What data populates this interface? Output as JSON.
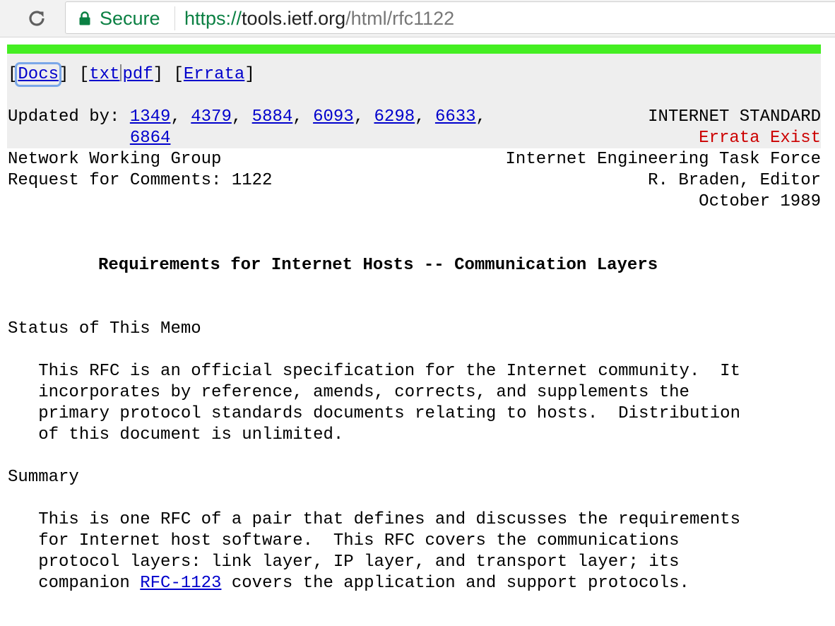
{
  "browser": {
    "secure_label": "Secure",
    "url_scheme": "https://",
    "url_host": "tools.ietf.org",
    "url_path": "/html/rfc1122"
  },
  "nav": {
    "docs": "Docs",
    "txt": "txt",
    "pdf": "pdf",
    "errata": "Errata"
  },
  "meta": {
    "updated_by_label": "Updated by: ",
    "updated_by": [
      "1349",
      "4379",
      "5884",
      "6093",
      "6298",
      "6633",
      "6864"
    ],
    "category": "INTERNET STANDARD",
    "errata_status": "Errata Exist"
  },
  "header": {
    "left": [
      "Network Working Group",
      "Request for Comments: 1122"
    ],
    "right": [
      "Internet Engineering Task Force",
      "R. Braden, Editor",
      "October 1989"
    ]
  },
  "title": "Requirements for Internet Hosts -- Communication Layers",
  "sections": {
    "status_heading": "Status of This Memo",
    "status_lines": [
      "   This RFC is an official specification for the Internet community.  It",
      "   incorporates by reference, amends, corrects, and supplements the",
      "   primary protocol standards documents relating to hosts.  Distribution",
      "   of this document is unlimited."
    ],
    "summary_heading": "Summary",
    "summary_lines": [
      "   This is one RFC of a pair that defines and discusses the requirements",
      "   for Internet host software.  This RFC covers the communications",
      "   protocol layers: link layer, IP layer, and transport layer; its"
    ],
    "summary_last_prefix": "   companion ",
    "summary_last_link": "RFC-1123",
    "summary_last_suffix": " covers the application and support protocols."
  },
  "colors": {
    "accent_bar": "#44ee22",
    "link": "#0000cc",
    "errata": "#cc0000",
    "secure": "#0b8043"
  }
}
